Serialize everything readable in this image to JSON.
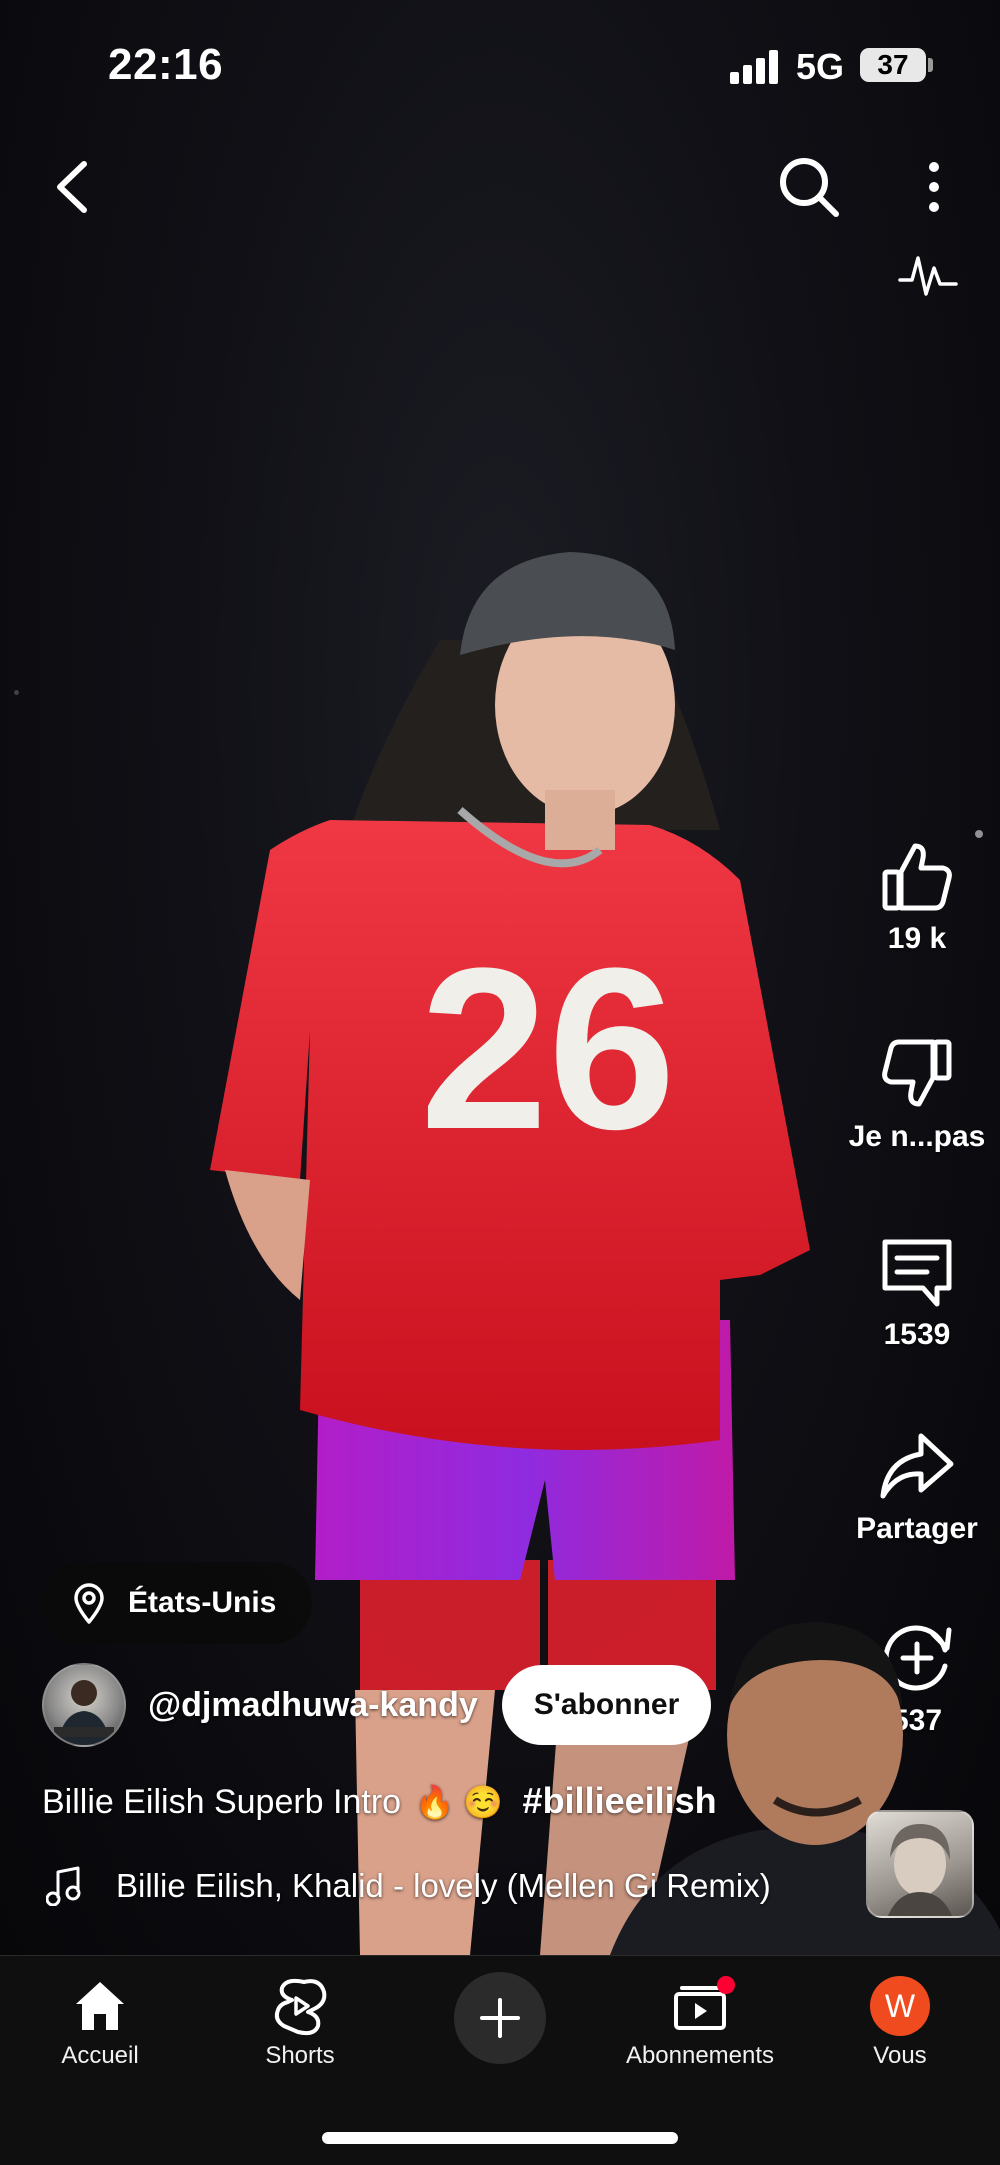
{
  "status_bar": {
    "time": "22:16",
    "network": "5G",
    "battery": "37"
  },
  "actions": {
    "like_count": "19 k",
    "dislike_label": "Je n...pas",
    "comment_count": "1539",
    "share_label": "Partager",
    "remix_count": "537"
  },
  "location": "États-Unis",
  "channel": {
    "handle": "@djmadhuwa-kandy",
    "subscribe_label": "S'abonner"
  },
  "caption": {
    "text": "Billie Eilish Superb Intro",
    "emojis": "🔥 ☺️",
    "hashtag": "#billieeilish"
  },
  "music": {
    "track": "Billie Eilish, Khalid - lovely (Mellen Gi Remix)"
  },
  "nav": {
    "home": "Accueil",
    "shorts": "Shorts",
    "subscriptions": "Abonnements",
    "you": "Vous",
    "you_initial": "W"
  },
  "colors": {
    "accent_red": "#ff0033",
    "you_avatar": "#ef4b1e",
    "nav_bg": "#0f0f0f"
  },
  "icons": {
    "back": "chevron-left-icon",
    "search": "search-icon",
    "more": "more-vert-icon",
    "pulse": "pulse-icon",
    "like": "thumb-up-icon",
    "dislike": "thumb-down-icon",
    "comment": "comment-icon",
    "share": "share-icon",
    "remix": "remix-icon",
    "location": "location-pin-icon",
    "music": "music-note-icon",
    "home": "home-icon",
    "shorts": "shorts-icon",
    "create": "plus-icon",
    "subscriptions": "subscriptions-icon"
  }
}
